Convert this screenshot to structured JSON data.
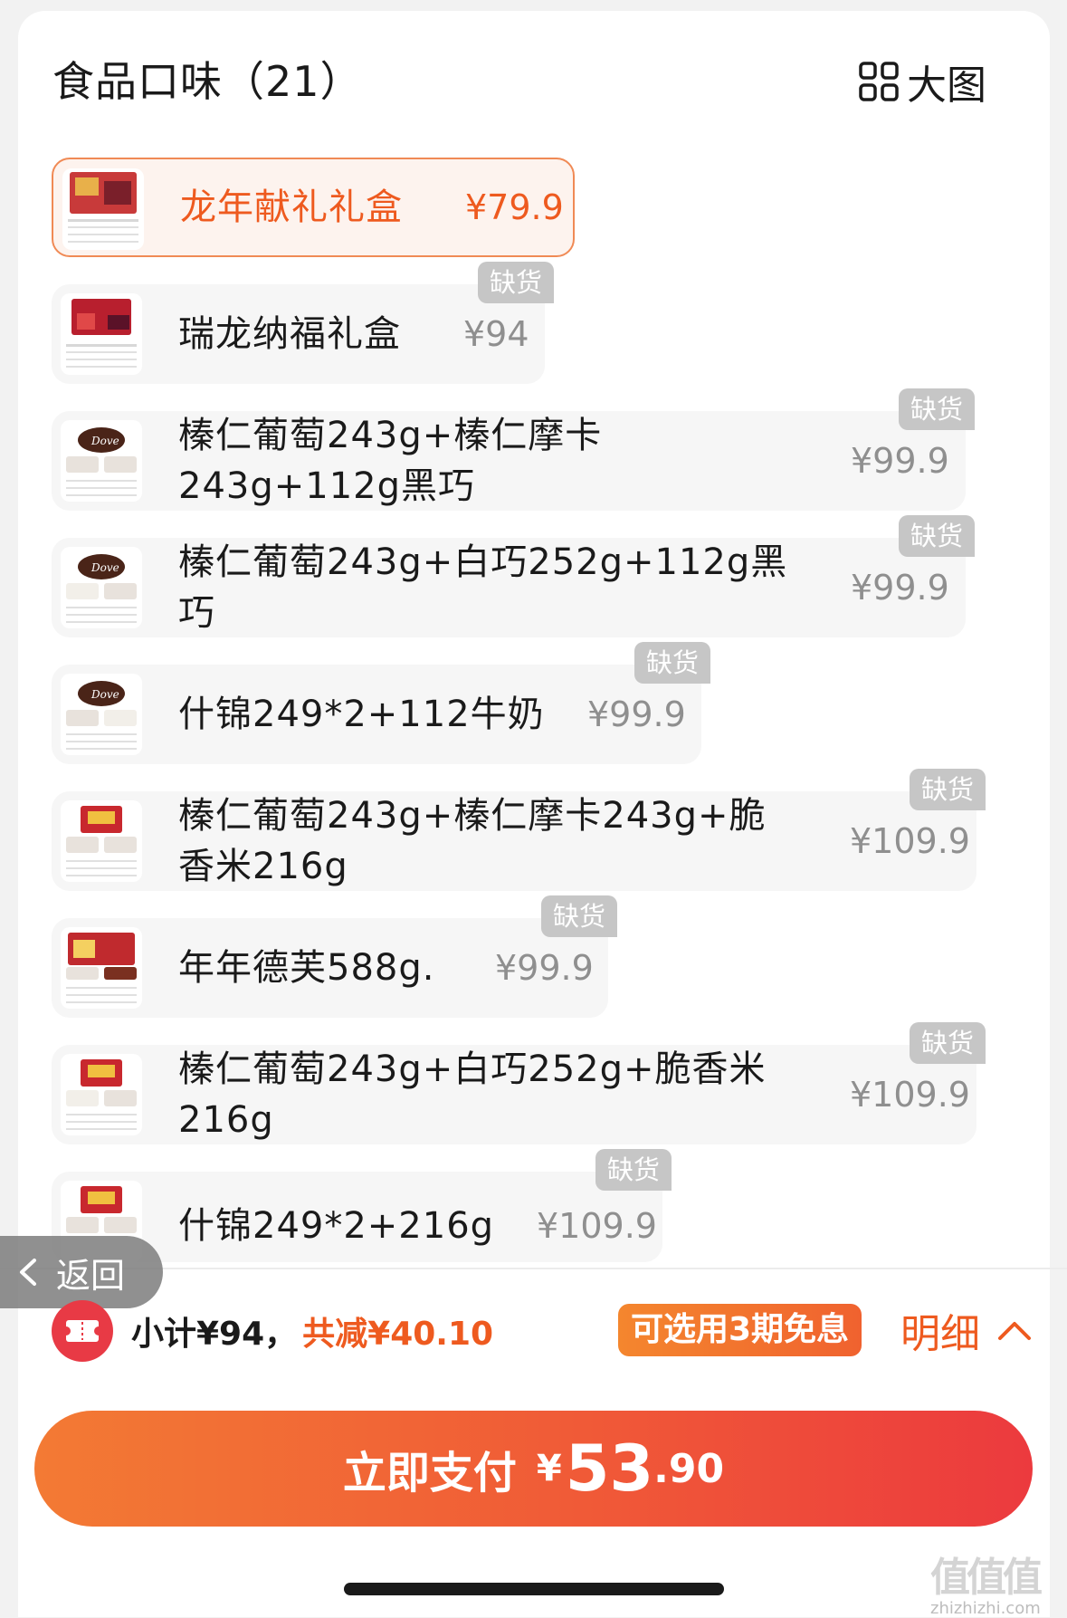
{
  "header": {
    "title": "食品口味（21）",
    "big_view_label": "大图"
  },
  "options": [
    {
      "name": "龙年献礼礼盒",
      "price": "¥79.9",
      "selected": true,
      "badge": ""
    },
    {
      "name": "瑞龙纳福礼盒",
      "price": "¥94",
      "selected": false,
      "badge": "缺货"
    },
    {
      "name": "榛仁葡萄243g+榛仁摩卡\n243g+112g黑巧",
      "price": "¥99.9",
      "selected": false,
      "badge": "缺货"
    },
    {
      "name": "榛仁葡萄243g+白巧252g+112g黑\n巧",
      "price": "¥99.9",
      "selected": false,
      "badge": "缺货"
    },
    {
      "name": "什锦249*2+112牛奶",
      "price": "¥99.9",
      "selected": false,
      "badge": "缺货"
    },
    {
      "name": "榛仁葡萄243g+榛仁摩卡243g+脆\n香米216g",
      "price": "¥109.9",
      "selected": false,
      "badge": "缺货"
    },
    {
      "name": "年年德芙588g.",
      "price": "¥99.9",
      "selected": false,
      "badge": "缺货"
    },
    {
      "name": "榛仁葡萄243g+白巧252g+脆香米\n216g",
      "price": "¥109.9",
      "selected": false,
      "badge": "缺货"
    },
    {
      "name": "什锦249*2+216g",
      "price": "¥109.9",
      "selected": false,
      "badge": "缺货"
    }
  ],
  "back_label": "返回",
  "summary": {
    "subtotal": "小计¥94，",
    "saved": "共减¥40.10",
    "installment": "可选用3期免息",
    "detail": "明细"
  },
  "pay": {
    "label": "立即支付",
    "currency": "¥",
    "amount_int": "53",
    "amount_dec": ".90"
  },
  "watermark": {
    "top": "值值值",
    "bottom": "zhizhizhi.com"
  },
  "colors": {
    "accent": "#ee5a1f",
    "badge": "#c6c6c6",
    "option_bg": "#f6f6f6"
  }
}
